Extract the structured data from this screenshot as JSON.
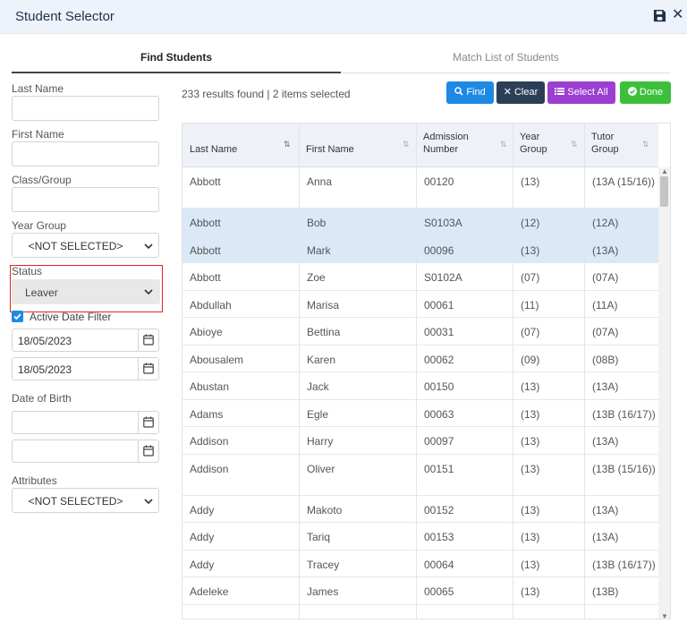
{
  "title": "Student Selector",
  "tabs": {
    "find": "Find Students",
    "match": "Match List of Students"
  },
  "form": {
    "last_name_label": "Last Name",
    "first_name_label": "First Name",
    "class_group_label": "Class/Group",
    "year_group_label": "Year Group",
    "year_group_value": "<NOT SELECTED>",
    "status_label": "Status",
    "status_value": "Leaver",
    "active_date_filter_label": "Active Date Filter",
    "date_from": "18/05/2023",
    "date_to": "18/05/2023",
    "dob_label": "Date of Birth",
    "attributes_label": "Attributes",
    "attributes_value": "<NOT SELECTED>"
  },
  "results_text": "233 results found | 2 items selected",
  "buttons": {
    "find": "Find",
    "clear": "Clear",
    "select_all": "Select All",
    "done": "Done"
  },
  "columns": [
    "Last Name",
    "First Name",
    "Admission Number",
    "Year Group",
    "Tutor Group"
  ],
  "column_lines": {
    "admission": [
      "Admission",
      "Number"
    ],
    "year": [
      "Year",
      "Group"
    ],
    "tutor": [
      "Tutor",
      "Group"
    ]
  },
  "rows": [
    [
      "Abbott",
      "Anna",
      "00120",
      "(13)",
      "(13A (15/16))"
    ],
    [
      "Abbott",
      "Bob",
      "S0103A",
      "(12)",
      "(12A)"
    ],
    [
      "Abbott",
      "Mark",
      "00096",
      "(13)",
      "(13A)"
    ],
    [
      "Abbott",
      "Zoe",
      "S0102A",
      "(07)",
      "(07A)"
    ],
    [
      "Abdullah",
      "Marisa",
      "00061",
      "(11)",
      "(11A)"
    ],
    [
      "Abioye",
      "Bettina",
      "00031",
      "(07)",
      "(07A)"
    ],
    [
      "Abousalem",
      "Karen",
      "00062",
      "(09)",
      "(08B)"
    ],
    [
      "Abustan",
      "Jack",
      "00150",
      "(13)",
      "(13A)"
    ],
    [
      "Adams",
      "Egle",
      "00063",
      "(13)",
      "(13B (16/17))"
    ],
    [
      "Addison",
      "Harry",
      "00097",
      "(13)",
      "(13A)"
    ],
    [
      "Addison",
      "Oliver",
      "00151",
      "(13)",
      "(13B (15/16))"
    ],
    [
      "Addy",
      "Makoto",
      "00152",
      "(13)",
      "(13A)"
    ],
    [
      "Addy",
      "Tariq",
      "00153",
      "(13)",
      "(13A)"
    ],
    [
      "Addy",
      "Tracey",
      "00064",
      "(13)",
      "(13B (16/17))"
    ],
    [
      "Adeleke",
      "James",
      "00065",
      "(13)",
      "(13B)"
    ]
  ],
  "selected_rows": [
    1,
    2
  ],
  "colors": {
    "accent": "#1e88e5",
    "selected_row": "#dbe8f8",
    "status_highlight": "#e0262b"
  }
}
